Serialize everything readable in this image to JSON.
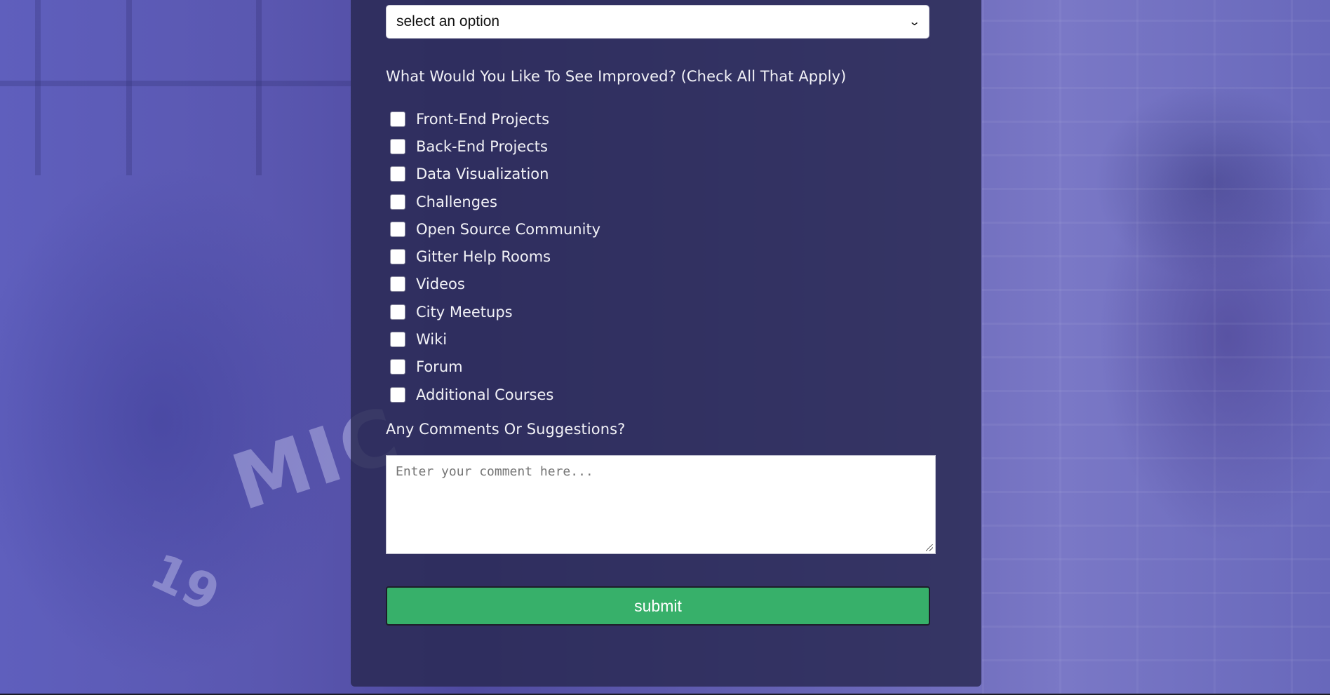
{
  "select": {
    "value": "select an option",
    "chevron_icon": "chevron-down-icon"
  },
  "improvements": {
    "question": "What Would You Like To See Improved? (Check All That Apply)",
    "options": [
      {
        "label": "Front-End Projects",
        "checked": false
      },
      {
        "label": "Back-End Projects",
        "checked": false
      },
      {
        "label": "Data Visualization",
        "checked": false
      },
      {
        "label": "Challenges",
        "checked": false
      },
      {
        "label": "Open Source Community",
        "checked": false
      },
      {
        "label": "Gitter Help Rooms",
        "checked": false
      },
      {
        "label": "Videos",
        "checked": false
      },
      {
        "label": "City Meetups",
        "checked": false
      },
      {
        "label": "Wiki",
        "checked": false
      },
      {
        "label": "Forum",
        "checked": false
      },
      {
        "label": "Additional Courses",
        "checked": false
      }
    ]
  },
  "comments": {
    "question": "Any Comments Or Suggestions?",
    "placeholder": "Enter your comment here...",
    "value": ""
  },
  "submit": {
    "label": "submit",
    "color": "#37b06a"
  },
  "colors": {
    "panel": "#28284f",
    "text": "#f2f2f7"
  }
}
